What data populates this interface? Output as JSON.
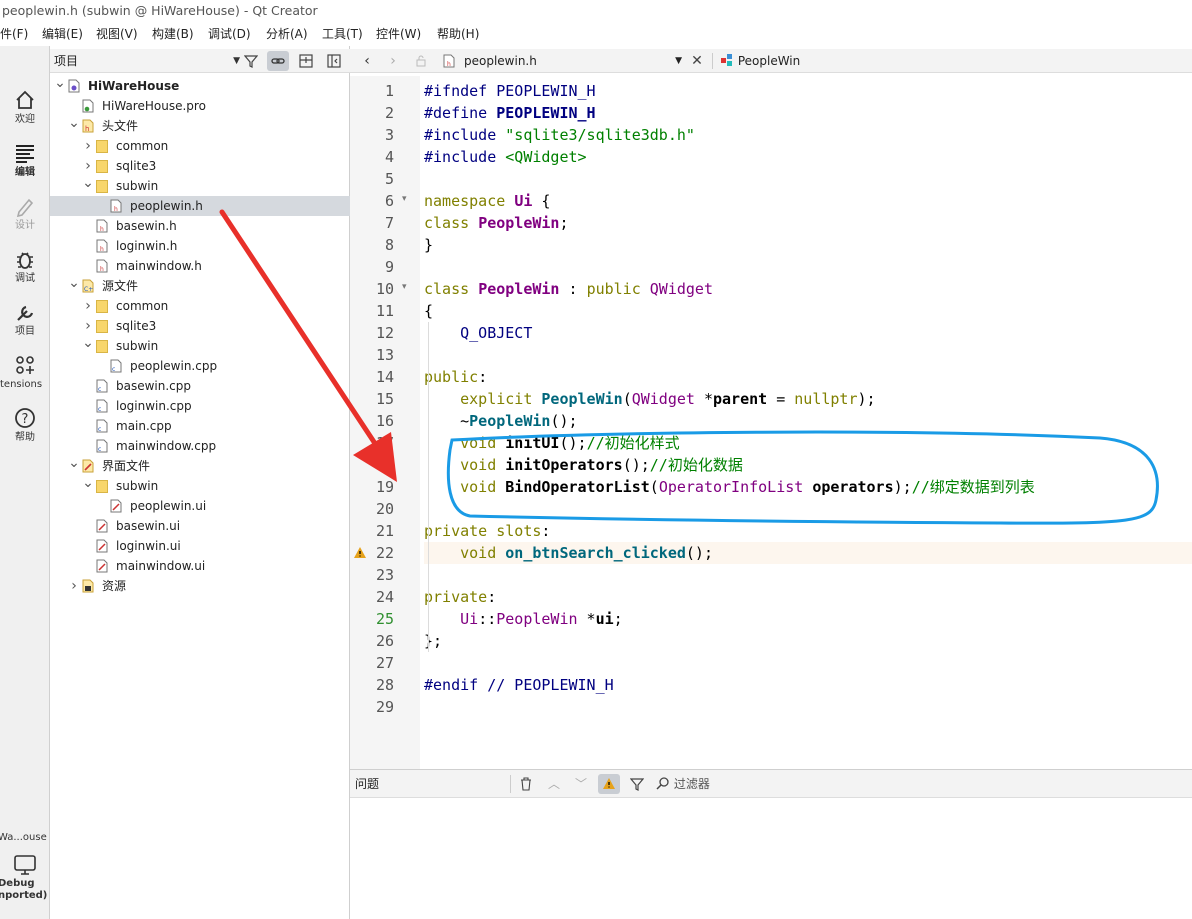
{
  "window": {
    "title": "peoplewin.h (subwin @ HiWareHouse) - Qt Creator"
  },
  "menu": [
    {
      "label": "件(F)"
    },
    {
      "label": "编辑(E)"
    },
    {
      "label": "视图(V)"
    },
    {
      "label": "构建(B)"
    },
    {
      "label": "调试(D)"
    },
    {
      "label": "分析(A)"
    },
    {
      "label": "工具(T)"
    },
    {
      "label": "控件(W)"
    },
    {
      "label": "帮助(H)"
    }
  ],
  "modes": [
    {
      "label": "欢迎",
      "icon": "home-icon"
    },
    {
      "label": "编辑",
      "icon": "edit-icon"
    },
    {
      "label": "设计",
      "icon": "design-pen-icon"
    },
    {
      "label": "调试",
      "icon": "bug-icon"
    },
    {
      "label": "项目",
      "icon": "wrench-icon"
    },
    {
      "label": "tensions",
      "icon": "extensions-icon"
    },
    {
      "label": "帮助",
      "icon": "help-icon"
    }
  ],
  "kit": {
    "project": "Wa...ouse",
    "config_line1": "Debug",
    "config_line2": "nported)"
  },
  "project_pane": {
    "selector": "项目"
  },
  "tree": [
    {
      "label": "HiWareHouse",
      "depth": 0,
      "arrow": "open",
      "icon": "project",
      "bold": true
    },
    {
      "label": "HiWareHouse.pro",
      "depth": 1,
      "arrow": "none",
      "icon": "pro"
    },
    {
      "label": "头文件",
      "depth": 1,
      "arrow": "open",
      "icon": "hfolder"
    },
    {
      "label": "common",
      "depth": 2,
      "arrow": "closed",
      "icon": "folder"
    },
    {
      "label": "sqlite3",
      "depth": 2,
      "arrow": "closed",
      "icon": "folder"
    },
    {
      "label": "subwin",
      "depth": 2,
      "arrow": "open",
      "icon": "folder"
    },
    {
      "label": "peoplewin.h",
      "depth": 3,
      "arrow": "none",
      "icon": "h",
      "selected": true
    },
    {
      "label": "basewin.h",
      "depth": 2,
      "arrow": "none",
      "icon": "h"
    },
    {
      "label": "loginwin.h",
      "depth": 2,
      "arrow": "none",
      "icon": "h"
    },
    {
      "label": "mainwindow.h",
      "depth": 2,
      "arrow": "none",
      "icon": "h"
    },
    {
      "label": "源文件",
      "depth": 1,
      "arrow": "open",
      "icon": "cfolder"
    },
    {
      "label": "common",
      "depth": 2,
      "arrow": "closed",
      "icon": "folder"
    },
    {
      "label": "sqlite3",
      "depth": 2,
      "arrow": "closed",
      "icon": "folder"
    },
    {
      "label": "subwin",
      "depth": 2,
      "arrow": "open",
      "icon": "folder"
    },
    {
      "label": "peoplewin.cpp",
      "depth": 3,
      "arrow": "none",
      "icon": "cpp"
    },
    {
      "label": "basewin.cpp",
      "depth": 2,
      "arrow": "none",
      "icon": "cpp"
    },
    {
      "label": "loginwin.cpp",
      "depth": 2,
      "arrow": "none",
      "icon": "cpp"
    },
    {
      "label": "main.cpp",
      "depth": 2,
      "arrow": "none",
      "icon": "cpp"
    },
    {
      "label": "mainwindow.cpp",
      "depth": 2,
      "arrow": "none",
      "icon": "cpp"
    },
    {
      "label": "界面文件",
      "depth": 1,
      "arrow": "open",
      "icon": "uifolder"
    },
    {
      "label": "subwin",
      "depth": 2,
      "arrow": "open",
      "icon": "folder"
    },
    {
      "label": "peoplewin.ui",
      "depth": 3,
      "arrow": "none",
      "icon": "ui"
    },
    {
      "label": "basewin.ui",
      "depth": 2,
      "arrow": "none",
      "icon": "ui"
    },
    {
      "label": "loginwin.ui",
      "depth": 2,
      "arrow": "none",
      "icon": "ui"
    },
    {
      "label": "mainwindow.ui",
      "depth": 2,
      "arrow": "none",
      "icon": "ui"
    },
    {
      "label": "资源",
      "depth": 1,
      "arrow": "closed",
      "icon": "res"
    }
  ],
  "editor": {
    "file": "peoplewin.h",
    "symbol": "PeopleWin",
    "current_line": 25,
    "warning_line": 22,
    "fold_lines": [
      6,
      10
    ]
  },
  "code": [
    [
      {
        "t": "#ifndef ",
        "c": "pp"
      },
      {
        "t": "PEOPLEWIN_H",
        "c": "pp"
      }
    ],
    [
      {
        "t": "#define ",
        "c": "pp"
      },
      {
        "t": "PEOPLEWIN_H",
        "c": "pp bo"
      }
    ],
    [
      {
        "t": "#include ",
        "c": "pp"
      },
      {
        "t": "\"sqlite3/sqlite3db.h\"",
        "c": "st"
      }
    ],
    [
      {
        "t": "#include ",
        "c": "pp"
      },
      {
        "t": "<QWidget>",
        "c": "st"
      }
    ],
    [],
    [
      {
        "t": "namespace ",
        "c": "kw"
      },
      {
        "t": "Ui",
        "c": "ty bo"
      },
      {
        "t": " {",
        "c": "pa"
      }
    ],
    [
      {
        "t": "class ",
        "c": "kw"
      },
      {
        "t": "PeopleWin",
        "c": "ty bo"
      },
      {
        "t": ";",
        "c": "pa"
      }
    ],
    [
      {
        "t": "}",
        "c": "pa"
      }
    ],
    [],
    [
      {
        "t": "class ",
        "c": "kw"
      },
      {
        "t": "PeopleWin",
        "c": "ty bo"
      },
      {
        "t": " : ",
        "c": "pa"
      },
      {
        "t": "public ",
        "c": "kw"
      },
      {
        "t": "QWidget",
        "c": "ty"
      }
    ],
    [
      {
        "t": "{",
        "c": "pa"
      }
    ],
    [
      {
        "t": "    ",
        "c": "pa"
      },
      {
        "t": "Q_OBJECT",
        "c": "pp"
      }
    ],
    [],
    [
      {
        "t": "public",
        "c": "kw"
      },
      {
        "t": ":",
        "c": "pa"
      }
    ],
    [
      {
        "t": "    ",
        "c": "pa"
      },
      {
        "t": "explicit ",
        "c": "kw"
      },
      {
        "t": "PeopleWin",
        "c": "fn"
      },
      {
        "t": "(",
        "c": "pa"
      },
      {
        "t": "QWidget",
        "c": "ty"
      },
      {
        "t": " *",
        "c": "pa"
      },
      {
        "t": "parent",
        "c": "bo"
      },
      {
        "t": " = ",
        "c": "pa"
      },
      {
        "t": "nullptr",
        "c": "kw"
      },
      {
        "t": ");",
        "c": "pa"
      }
    ],
    [
      {
        "t": "    ~",
        "c": "pa"
      },
      {
        "t": "PeopleWin",
        "c": "fn"
      },
      {
        "t": "();",
        "c": "pa"
      }
    ],
    [
      {
        "t": "    ",
        "c": "pa"
      },
      {
        "t": "void ",
        "c": "kw"
      },
      {
        "t": "initUI",
        "c": "bo"
      },
      {
        "t": "();",
        "c": "pa"
      },
      {
        "t": "//初始化样式",
        "c": "cm"
      }
    ],
    [
      {
        "t": "    ",
        "c": "pa"
      },
      {
        "t": "void ",
        "c": "kw"
      },
      {
        "t": "initOperators",
        "c": "bo"
      },
      {
        "t": "();",
        "c": "pa"
      },
      {
        "t": "//初始化数据",
        "c": "cm"
      }
    ],
    [
      {
        "t": "    ",
        "c": "pa"
      },
      {
        "t": "void ",
        "c": "kw"
      },
      {
        "t": "BindOperatorList",
        "c": "bo"
      },
      {
        "t": "(",
        "c": "pa"
      },
      {
        "t": "OperatorInfoList",
        "c": "ty"
      },
      {
        "t": " ",
        "c": "pa"
      },
      {
        "t": "operators",
        "c": "bo"
      },
      {
        "t": ");",
        "c": "pa"
      },
      {
        "t": "//绑定数据到列表",
        "c": "cm"
      }
    ],
    [],
    [
      {
        "t": "private ",
        "c": "kw"
      },
      {
        "t": "slots",
        "c": "kw"
      },
      {
        "t": ":",
        "c": "pa"
      }
    ],
    [
      {
        "t": "    ",
        "c": "pa"
      },
      {
        "t": "void ",
        "c": "kw"
      },
      {
        "t": "on_btnSearch_clicked",
        "c": "fn"
      },
      {
        "t": "();",
        "c": "pa"
      }
    ],
    [],
    [
      {
        "t": "private",
        "c": "kw"
      },
      {
        "t": ":",
        "c": "pa"
      }
    ],
    [
      {
        "t": "    ",
        "c": "pa"
      },
      {
        "t": "Ui",
        "c": "ty"
      },
      {
        "t": "::",
        "c": "pa"
      },
      {
        "t": "PeopleWin",
        "c": "ty"
      },
      {
        "t": " *",
        "c": "pa"
      },
      {
        "t": "ui",
        "c": "bo"
      },
      {
        "t": ";",
        "c": "pa"
      }
    ],
    [
      {
        "t": "};",
        "c": "pa"
      }
    ],
    [],
    [
      {
        "t": "#endif ",
        "c": "pp"
      },
      {
        "t": "// PEOPLEWIN_H",
        "c": "pp"
      }
    ],
    []
  ],
  "issues": {
    "title": "问题",
    "filter_placeholder": "过滤器"
  },
  "colors": {
    "annotation_arrow": "#e8302a",
    "annotation_circle": "#1a9be6",
    "keyword": "#808000",
    "type": "#800080",
    "preprocessor": "#000080"
  }
}
